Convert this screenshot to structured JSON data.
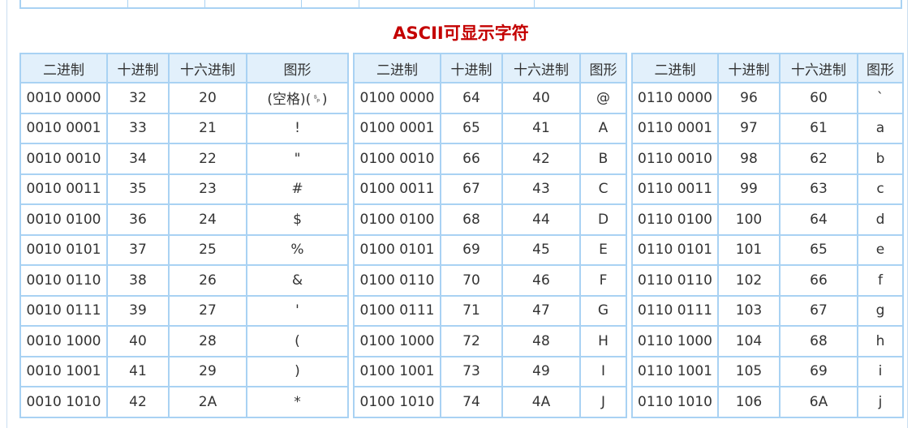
{
  "title": "ASCII可显示字符",
  "headers": [
    "二进制",
    "十进制",
    "十六进制",
    "图形"
  ],
  "chart_data": {
    "type": "table",
    "title": "ASCII可显示字符",
    "columns": [
      "二进制",
      "十进制",
      "十六进制",
      "图形"
    ],
    "tables": [
      {
        "rows": [
          [
            "0010 0000",
            "32",
            "20",
            "(空格)(␠)"
          ],
          [
            "0010 0001",
            "33",
            "21",
            "!"
          ],
          [
            "0010 0010",
            "34",
            "22",
            "\""
          ],
          [
            "0010 0011",
            "35",
            "23",
            "#"
          ],
          [
            "0010 0100",
            "36",
            "24",
            "$"
          ],
          [
            "0010 0101",
            "37",
            "25",
            "%"
          ],
          [
            "0010 0110",
            "38",
            "26",
            "&"
          ],
          [
            "0010 0111",
            "39",
            "27",
            "'"
          ],
          [
            "0010 1000",
            "40",
            "28",
            "("
          ],
          [
            "0010 1001",
            "41",
            "29",
            ")"
          ],
          [
            "0010 1010",
            "42",
            "2A",
            "*"
          ]
        ]
      },
      {
        "rows": [
          [
            "0100 0000",
            "64",
            "40",
            "@"
          ],
          [
            "0100 0001",
            "65",
            "41",
            "A"
          ],
          [
            "0100 0010",
            "66",
            "42",
            "B"
          ],
          [
            "0100 0011",
            "67",
            "43",
            "C"
          ],
          [
            "0100 0100",
            "68",
            "44",
            "D"
          ],
          [
            "0100 0101",
            "69",
            "45",
            "E"
          ],
          [
            "0100 0110",
            "70",
            "46",
            "F"
          ],
          [
            "0100 0111",
            "71",
            "47",
            "G"
          ],
          [
            "0100 1000",
            "72",
            "48",
            "H"
          ],
          [
            "0100 1001",
            "73",
            "49",
            "I"
          ],
          [
            "0100 1010",
            "74",
            "4A",
            "J"
          ]
        ]
      },
      {
        "rows": [
          [
            "0110 0000",
            "96",
            "60",
            "`"
          ],
          [
            "0110 0001",
            "97",
            "61",
            "a"
          ],
          [
            "0110 0010",
            "98",
            "62",
            "b"
          ],
          [
            "0110 0011",
            "99",
            "63",
            "c"
          ],
          [
            "0110 0100",
            "100",
            "64",
            "d"
          ],
          [
            "0110 0101",
            "101",
            "65",
            "e"
          ],
          [
            "0110 0110",
            "102",
            "66",
            "f"
          ],
          [
            "0110 0111",
            "103",
            "67",
            "g"
          ],
          [
            "0110 1000",
            "104",
            "68",
            "h"
          ],
          [
            "0110 1001",
            "105",
            "69",
            "i"
          ],
          [
            "0110 1010",
            "106",
            "6A",
            "j"
          ]
        ]
      }
    ]
  }
}
